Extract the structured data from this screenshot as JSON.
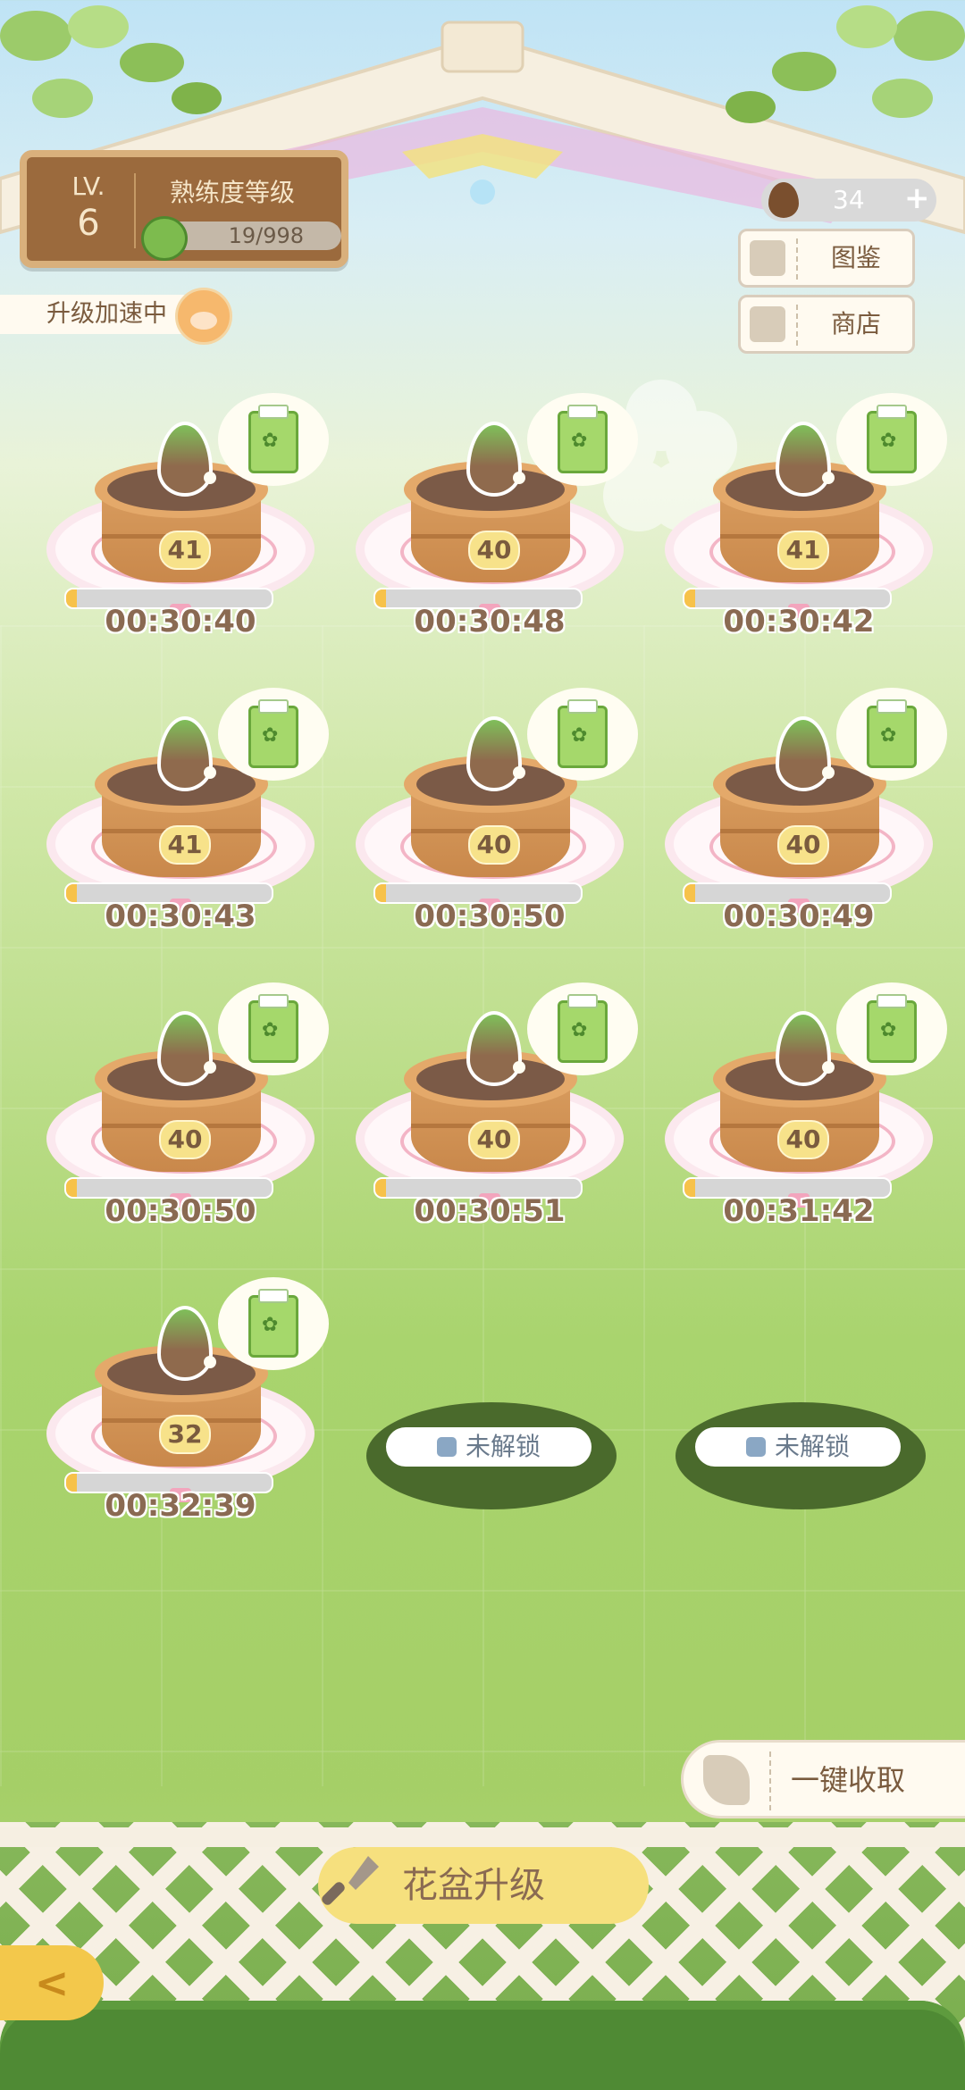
{
  "level": {
    "label": "LV.",
    "value": "6"
  },
  "proficiency": {
    "title": "熟练度等级",
    "progress_text": "19/998"
  },
  "upgrade_status": "升级加速中",
  "currency": {
    "value": "34",
    "add": "+"
  },
  "side_buttons": [
    {
      "label": "图鉴",
      "icon": "book-icon"
    },
    {
      "label": "商店",
      "icon": "shop-icon"
    }
  ],
  "pots": [
    {
      "level": "41",
      "timer": "00:30:40",
      "progress": 0.05
    },
    {
      "level": "40",
      "timer": "00:30:48",
      "progress": 0.05
    },
    {
      "level": "41",
      "timer": "00:30:42",
      "progress": 0.05
    },
    {
      "level": "41",
      "timer": "00:30:43",
      "progress": 0.05
    },
    {
      "level": "40",
      "timer": "00:30:50",
      "progress": 0.05
    },
    {
      "level": "40",
      "timer": "00:30:49",
      "progress": 0.05
    },
    {
      "level": "40",
      "timer": "00:30:50",
      "progress": 0.05
    },
    {
      "level": "40",
      "timer": "00:30:51",
      "progress": 0.05
    },
    {
      "level": "40",
      "timer": "00:31:42",
      "progress": 0.05
    },
    {
      "level": "32",
      "timer": "00:32:39",
      "progress": 0.05
    }
  ],
  "locked_slots": [
    {
      "label": "未解锁"
    },
    {
      "label": "未解锁"
    }
  ],
  "harvest_all": {
    "label": "一键收取"
  },
  "pot_upgrade": {
    "label": "花盆升级"
  },
  "back": {
    "icon": "back-arrow-icon",
    "glyph": "<"
  },
  "colors": {
    "accent": "#f6e07e",
    "wood": "#9b6a3d",
    "pot": "#d99d5f",
    "lock_base": "#4a6a2c"
  }
}
